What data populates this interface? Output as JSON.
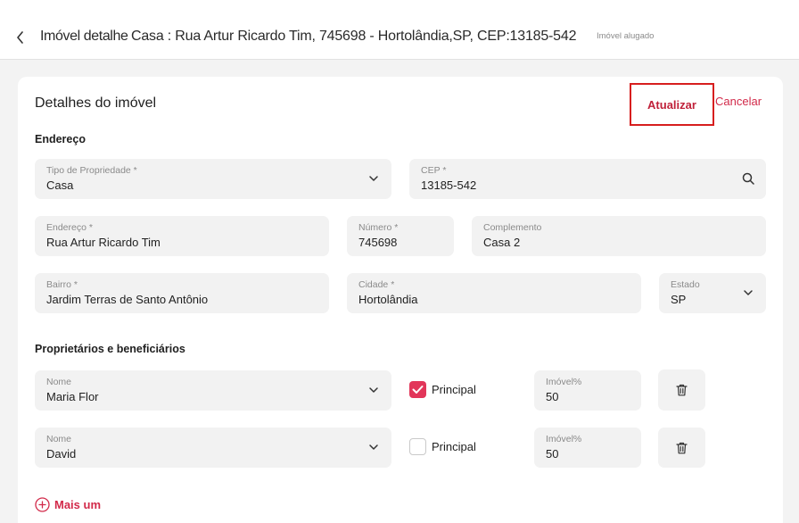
{
  "header": {
    "title": "Imóvel detalhe",
    "address": "Casa : Rua Artur Ricardo Tim, 745698 - Hortolândia,SP, CEP:13185-542",
    "status": "Imóvel alugado"
  },
  "card": {
    "title": "Detalhes do imóvel",
    "update_label": "Atualizar",
    "cancel_label": "Cancelar"
  },
  "address_section": {
    "title": "Endereço",
    "property_type": {
      "label": "Tipo de Propriedade *",
      "value": "Casa",
      "icon": "chevron-down-icon"
    },
    "cep": {
      "label": "CEP *",
      "value": "13185-542",
      "icon": "search-icon"
    },
    "street": {
      "label": "Endereço *",
      "value": "Rua Artur Ricardo Tim"
    },
    "number": {
      "label": "Número *",
      "value": "745698"
    },
    "complement": {
      "label": "Complemento",
      "value": "Casa 2"
    },
    "neighborhood": {
      "label": "Bairro *",
      "value": "Jardim Terras de Santo Antônio"
    },
    "city": {
      "label": "Cidade *",
      "value": "Hortolândia"
    },
    "state": {
      "label": "Estado",
      "value": "SP",
      "icon": "chevron-down-icon"
    }
  },
  "owners_section": {
    "title": "Proprietários e beneficiários",
    "owners": [
      {
        "name_label": "Nome",
        "name": "Maria Flor",
        "principal_label": "Principal",
        "principal": true,
        "percent_label": "Imóvel%",
        "percent": "50"
      },
      {
        "name_label": "Nome",
        "name": "David",
        "principal_label": "Principal",
        "principal": false,
        "percent_label": "Imóvel%",
        "percent": "50"
      }
    ],
    "add_more_label": "Mais um"
  },
  "colors": {
    "accent": "#d22a4a",
    "checkbox_on": "#e2365a",
    "highlight_border": "#d71e1e",
    "field_bg": "#f2f2f2"
  }
}
